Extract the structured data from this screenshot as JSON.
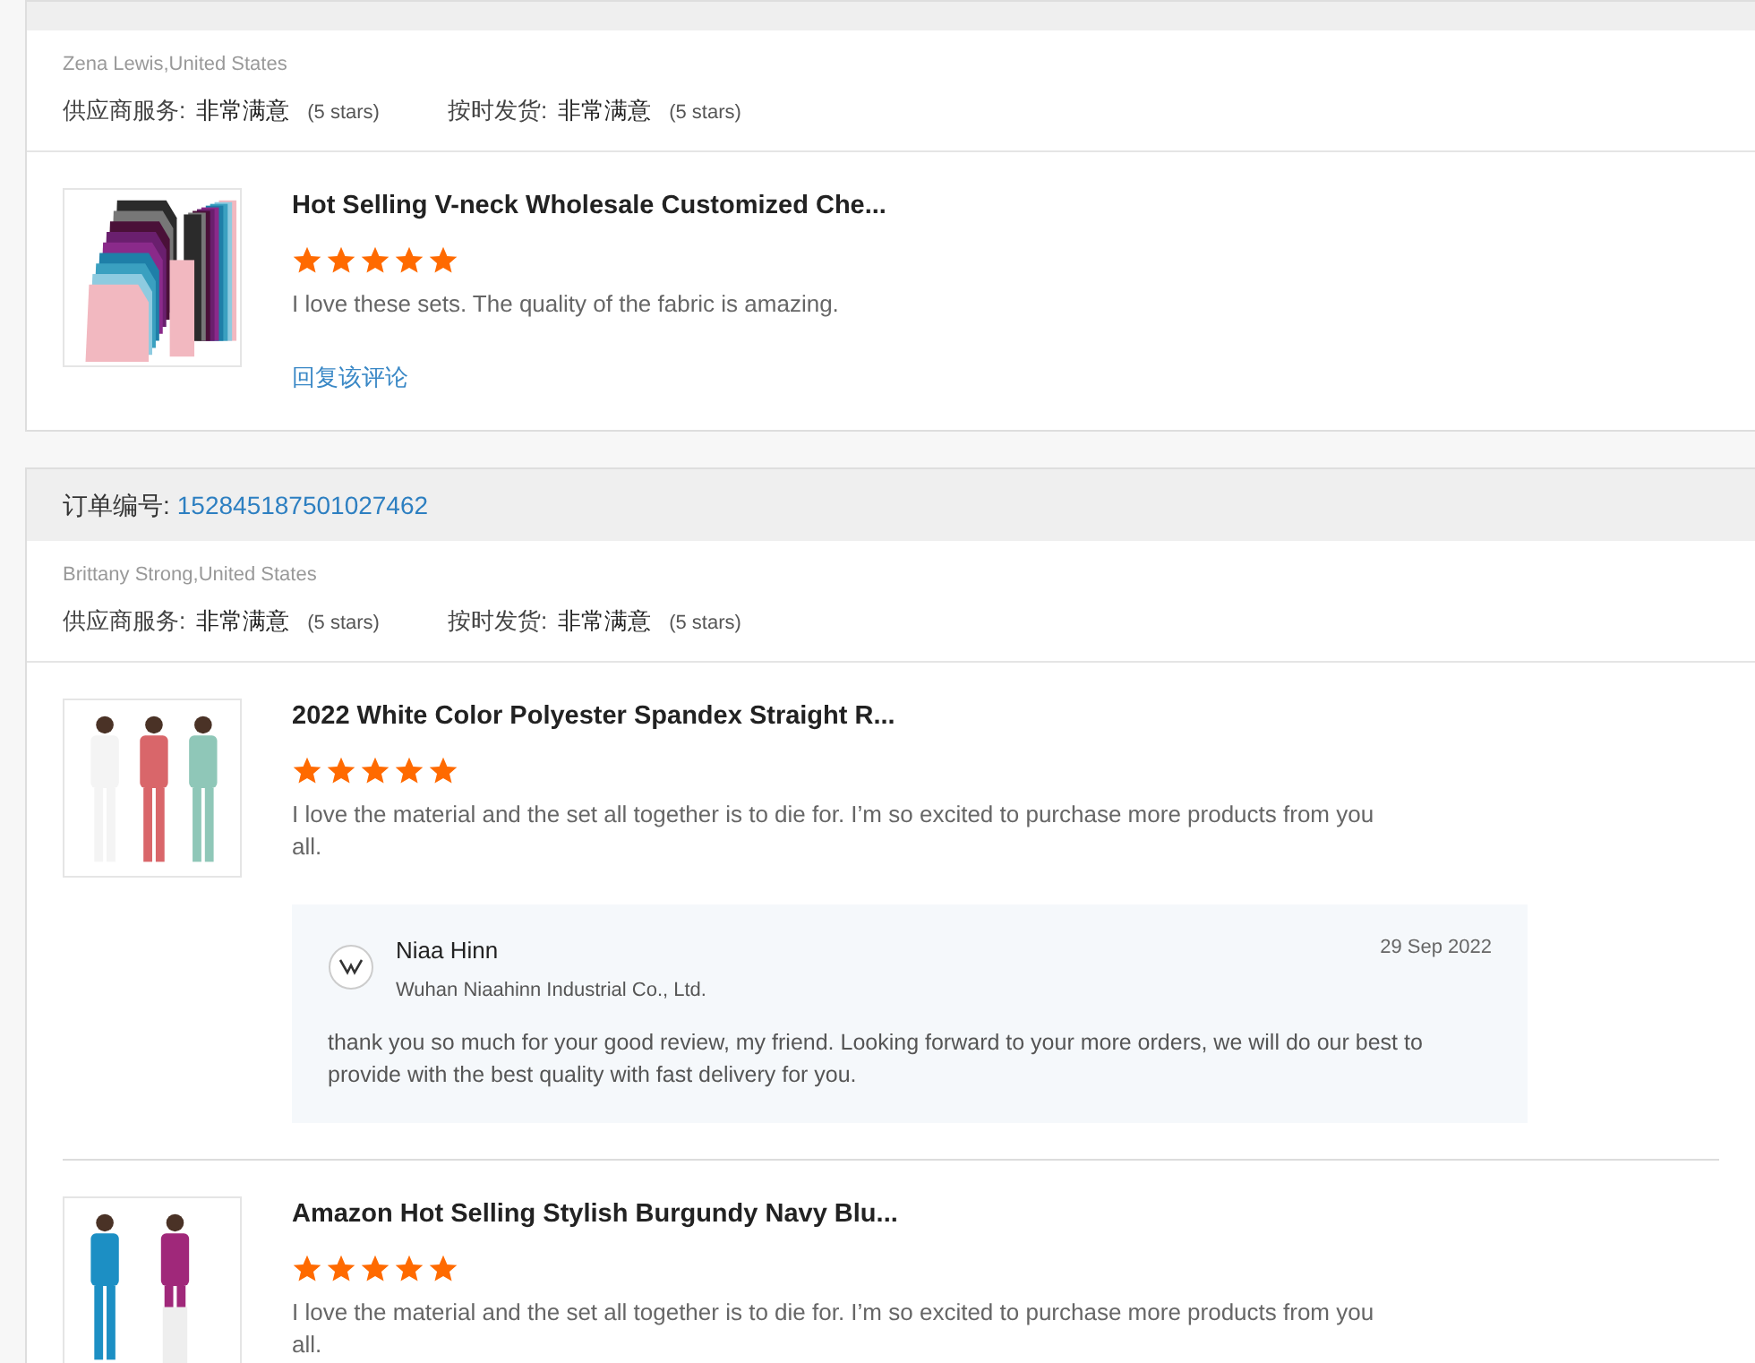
{
  "orders": [
    {
      "reviewer": "Zena Lewis,United States",
      "ratings": [
        {
          "label": "供应商服务:",
          "value": "非常满意",
          "note": "(5 stars)"
        },
        {
          "label": "按时发货:",
          "value": "非常满意",
          "note": "(5 stars)"
        }
      ],
      "items": [
        {
          "title": "Hot Selling V-neck Wholesale Customized Che...",
          "stars": 5,
          "comment": "I love these sets. The quality of the fabric is amazing.",
          "reply_link": "回复该评论"
        }
      ]
    },
    {
      "order_label": "订单编号:",
      "order_number": "152845187501027462",
      "reviewer": "Brittany Strong,United States",
      "ratings": [
        {
          "label": "供应商服务:",
          "value": "非常满意",
          "note": "(5 stars)"
        },
        {
          "label": "按时发货:",
          "value": "非常满意",
          "note": "(5 stars)"
        }
      ],
      "items": [
        {
          "title": "2022 White Color Polyester Spandex Straight R...",
          "stars": 5,
          "comment": "I love the material and the set all together is to die for. I’m so excited to purchase more products from you all.",
          "reply": {
            "name": "Niaa Hinn",
            "company": "Wuhan Niaahinn Industrial Co., Ltd.",
            "date": "29 Sep 2022",
            "text": "thank you so much for your good review, my friend. Looking forward to your more orders, we will do our best to provide with the best quality with fast delivery for you."
          }
        },
        {
          "title": "Amazon Hot Selling Stylish Burgundy Navy Blu...",
          "stars": 5,
          "comment": "I love the material and the set all together is to die for. I’m so excited to purchase more products from you all."
        }
      ]
    }
  ]
}
